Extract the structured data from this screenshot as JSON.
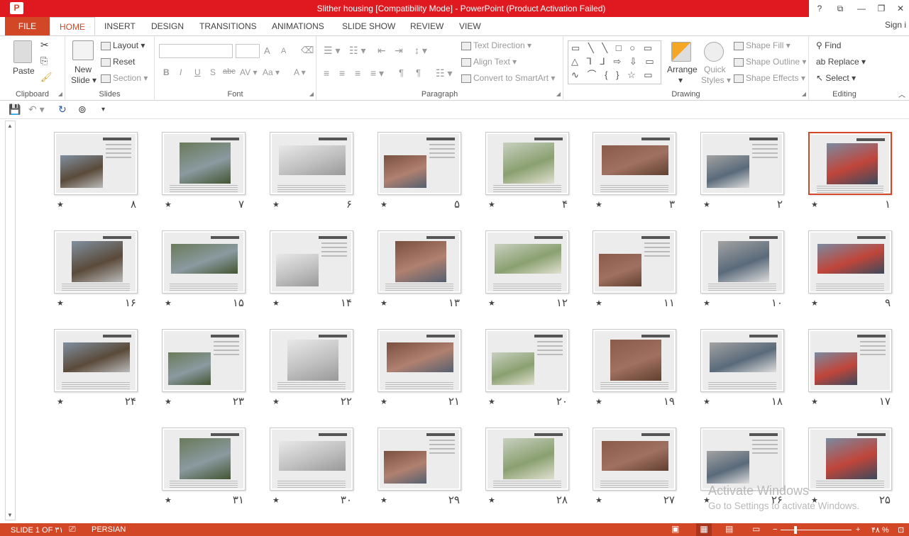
{
  "window": {
    "title": "Slither housing [Compatibility Mode] - PowerPoint (Product Activation Failed)",
    "app_icon": "P",
    "help": "?",
    "restore_ribbon": "⧉",
    "minimize": "—",
    "maximize": "❐",
    "close": "✕"
  },
  "tabs": {
    "file": "FILE",
    "items": [
      "HOME",
      "INSERT",
      "DESIGN",
      "TRANSITIONS",
      "ANIMATIONS",
      "SLIDE SHOW",
      "REVIEW",
      "VIEW"
    ],
    "signin": "Sign i"
  },
  "ribbon": {
    "clipboard": {
      "label": "Clipboard",
      "paste": "Paste"
    },
    "slides": {
      "label": "Slides",
      "new_slide": "New",
      "new_slide2": "Slide ▾",
      "layout": "Layout ▾",
      "reset": "Reset",
      "section": "Section ▾"
    },
    "font": {
      "label": "Font",
      "bold": "B",
      "italic": "I",
      "underline": "U",
      "shadow": "S",
      "strike": "abc",
      "spacing": "AV ▾",
      "case": "Aa ▾",
      "color": "A ▾",
      "grow": "A",
      "shrink": "A"
    },
    "paragraph": {
      "label": "Paragraph",
      "text_direction": "Text Direction ▾",
      "align_text": "Align Text ▾",
      "smartart": "Convert to SmartArt ▾"
    },
    "drawing": {
      "label": "Drawing",
      "arrange": "Arrange",
      "arrange2": "▾",
      "quick_styles": "Quick",
      "quick_styles2": "Styles ▾",
      "shape_fill": "Shape Fill ▾",
      "shape_outline": "Shape Outline ▾",
      "shape_effects": "Shape Effects ▾",
      "gallery": "▭ ╲ ╲ □ ○ ▭ △ ⅂ ⅃ ⇨ ⇩ ▭ ∿ ⌒ { } ☆ ▭"
    },
    "editing": {
      "label": "Editing",
      "find": "Find",
      "replace": "Replace ▾",
      "select": "Select ▾"
    },
    "collapse": "︿"
  },
  "qat": {
    "save": "💾",
    "undo": "↶ ▾",
    "redo": "↻",
    "present": "⊚",
    "customize": "▾"
  },
  "slides": [
    {
      "num": "۱",
      "star": "★",
      "selected": true
    },
    {
      "num": "۲",
      "star": "★"
    },
    {
      "num": "۳",
      "star": "★"
    },
    {
      "num": "۴",
      "star": "★"
    },
    {
      "num": "۵",
      "star": "★"
    },
    {
      "num": "۶",
      "star": "★"
    },
    {
      "num": "۷",
      "star": "★"
    },
    {
      "num": "۸",
      "star": "★"
    },
    {
      "num": "۹",
      "star": "★"
    },
    {
      "num": "۱۰",
      "star": "★"
    },
    {
      "num": "۱۱",
      "star": "★"
    },
    {
      "num": "۱۲",
      "star": "★"
    },
    {
      "num": "۱۳",
      "star": "★"
    },
    {
      "num": "۱۴",
      "star": "★"
    },
    {
      "num": "۱۵",
      "star": "★"
    },
    {
      "num": "۱۶",
      "star": "★"
    },
    {
      "num": "۱۷",
      "star": "★"
    },
    {
      "num": "۱۸",
      "star": "★"
    },
    {
      "num": "۱۹",
      "star": "★"
    },
    {
      "num": "۲۰",
      "star": "★"
    },
    {
      "num": "۲۱",
      "star": "★"
    },
    {
      "num": "۲۲",
      "star": "★"
    },
    {
      "num": "۲۳",
      "star": "★"
    },
    {
      "num": "۲۴",
      "star": "★"
    },
    {
      "num": "۲۵",
      "star": "★"
    },
    {
      "num": "۲۶",
      "star": "★"
    },
    {
      "num": "۲۷",
      "star": "★"
    },
    {
      "num": "۲۸",
      "star": "★"
    },
    {
      "num": "۲۹",
      "star": "★"
    },
    {
      "num": "۳۰",
      "star": "★"
    },
    {
      "num": "۳۱",
      "star": "★"
    }
  ],
  "watermark": {
    "line1": "Activate Windows",
    "line2": "Go to Settings to activate Windows."
  },
  "status": {
    "slide": "SLIDE 1 OF ۳۱",
    "language": "PERSIAN",
    "zoom": "۴۸ %",
    "minus": "−",
    "plus": "+"
  },
  "colors": {
    "accent": "#d24726",
    "title_red": "#e0181f"
  }
}
